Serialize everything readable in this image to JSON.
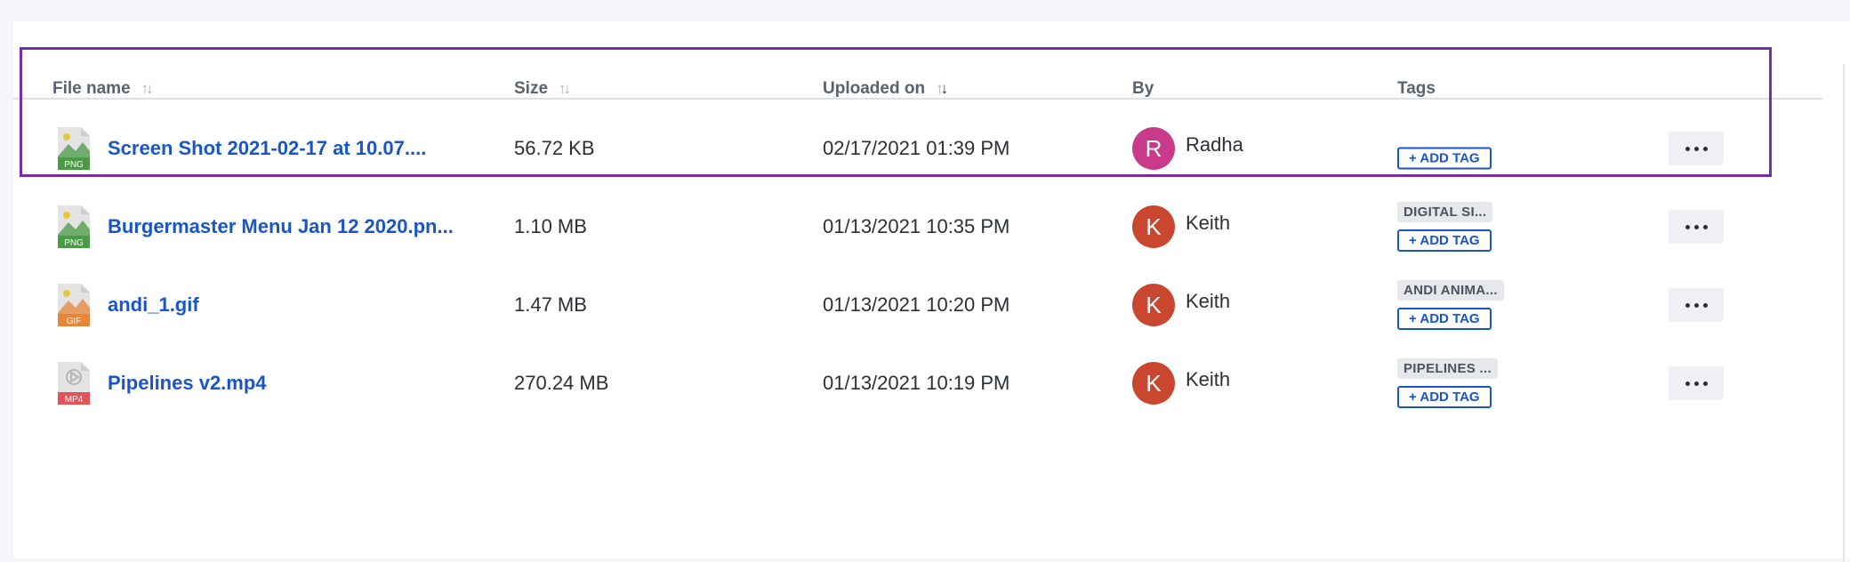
{
  "columns": {
    "file_name": "File name",
    "size": "Size",
    "uploaded_on": "Uploaded on",
    "by": "By",
    "tags": "Tags"
  },
  "sort": {
    "inactive_arrows": "↑↓",
    "uploaded_up": "↑",
    "uploaded_down": "↓"
  },
  "files": [
    {
      "name": "Screen Shot 2021-02-17 at 10.07....",
      "type_label": "PNG",
      "type_color": "#4a9a46",
      "icon": "png-image-icon",
      "size": "56.72 KB",
      "uploaded": "02/17/2021 01:39 PM",
      "user_initial": "R",
      "user": "Radha",
      "avatar_color": "#c83a8a",
      "tag": "",
      "add_tag": "+ ADD TAG"
    },
    {
      "name": "Burgermaster Menu Jan 12 2020.pn...",
      "type_label": "PNG",
      "type_color": "#4a9a46",
      "icon": "png-image-icon",
      "size": "1.10 MB",
      "uploaded": "01/13/2021 10:35 PM",
      "user_initial": "K",
      "user": "Keith",
      "avatar_color": "#c9472f",
      "tag": "DIGITAL SI...",
      "add_tag": "+ ADD TAG"
    },
    {
      "name": "andi_1.gif",
      "type_label": "GIF",
      "type_color": "#e8863a",
      "icon": "gif-image-icon",
      "size": "1.47 MB",
      "uploaded": "01/13/2021 10:20 PM",
      "user_initial": "K",
      "user": "Keith",
      "avatar_color": "#c9472f",
      "tag": "ANDI ANIMA...",
      "add_tag": "+ ADD TAG"
    },
    {
      "name": "Pipelines v2.mp4",
      "type_label": "MP4",
      "type_color": "#e5535a",
      "icon": "mp4-video-icon",
      "size": "270.24 MB",
      "uploaded": "01/13/2021 10:19 PM",
      "user_initial": "K",
      "user": "Keith",
      "avatar_color": "#c9472f",
      "tag": "PIPELINES ...",
      "add_tag": "+ ADD TAG"
    }
  ],
  "colors": {
    "link": "#1a55c7",
    "highlight": "#7a2ea6"
  }
}
